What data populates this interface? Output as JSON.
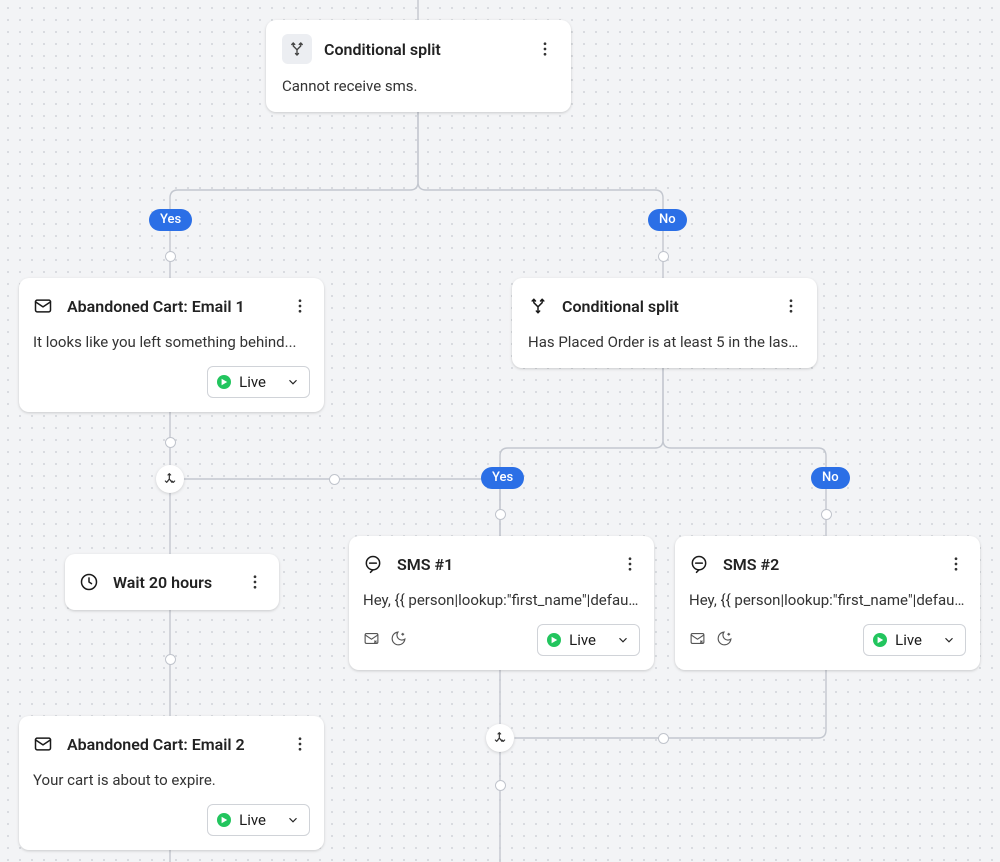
{
  "colors": {
    "accent": "#2b6fe6",
    "live": "#22c55e"
  },
  "branch_labels": {
    "yes": "Yes",
    "no": "No"
  },
  "nodes": {
    "root_split": {
      "title": "Conditional split",
      "desc": "Cannot receive sms."
    },
    "email1": {
      "title": "Abandoned Cart: Email 1",
      "desc": "It looks like you left something behind...",
      "status": "Live"
    },
    "split2": {
      "title": "Conditional split",
      "desc": "Has Placed Order is at least 5 in the last …"
    },
    "wait": {
      "title": "Wait 20 hours"
    },
    "sms1": {
      "title": "SMS #1",
      "desc": "Hey, {{ person|lookup:\"first_name\"|defaul…",
      "status": "Live"
    },
    "sms2": {
      "title": "SMS #2",
      "desc": "Hey, {{ person|lookup:\"first_name\"|defaul…",
      "status": "Live"
    },
    "email2": {
      "title": "Abandoned Cart: Email 2",
      "desc": "Your cart is about to expire.",
      "status": "Live"
    }
  }
}
